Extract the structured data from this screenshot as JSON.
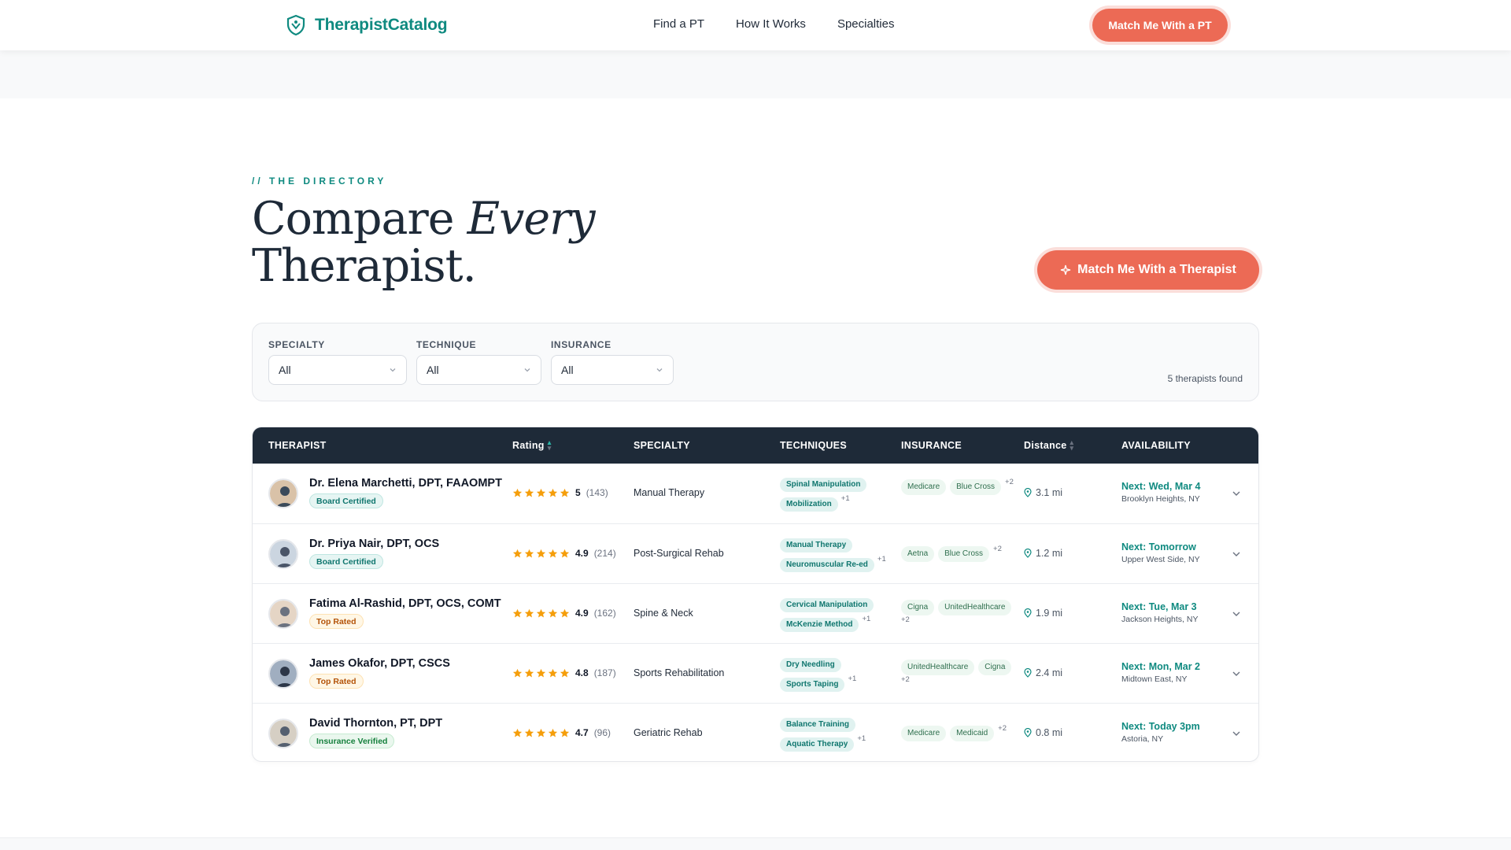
{
  "nav": {
    "brand": "TherapistCatalog",
    "links": [
      "Find a PT",
      "How It Works",
      "Specialties"
    ],
    "cta": "Match Me With a PT"
  },
  "hero": {
    "eyebrow": "// THE DIRECTORY",
    "title_line1_a": "Compare ",
    "title_line1_b": "Every",
    "title_line2": "Therapist.",
    "cta": "Match Me With a Therapist"
  },
  "filters": {
    "specialty": {
      "label": "SPECIALTY",
      "value": "All"
    },
    "technique": {
      "label": "TECHNIQUE",
      "value": "All"
    },
    "insurance": {
      "label": "INSURANCE",
      "value": "All"
    },
    "results": "5 therapists found"
  },
  "table": {
    "headers": {
      "therapist": "THERAPIST",
      "rating": "Rating",
      "specialty": "SPECIALTY",
      "techniques": "TECHNIQUES",
      "insurance": "INSURANCE",
      "distance": "Distance",
      "availability": "AVAILABILITY"
    },
    "rows": [
      {
        "name": "Dr. Elena Marchetti, DPT, FAAOMPT",
        "badge": "Board Certified",
        "badge_color": "#0f766e",
        "rating": "5",
        "reviews": "(143)",
        "stars": 5,
        "specialty": "Manual Therapy",
        "techniques": [
          "Spinal Manipulation",
          "Mobilization"
        ],
        "tech_more": "+1",
        "insurance": [
          "Medicare",
          "Blue Cross"
        ],
        "ins_more": "+2",
        "distance": "3.1 mi",
        "next": "Next: Wed, Mar 4",
        "location": "Brooklyn Heights, NY"
      },
      {
        "name": "Dr. Priya Nair, DPT, OCS",
        "badge": "Board Certified",
        "badge_color": "#0f766e",
        "rating": "4.9",
        "reviews": "(214)",
        "stars": 5,
        "specialty": "Post-Surgical Rehab",
        "techniques": [
          "Manual Therapy",
          "Neuromuscular Re-ed"
        ],
        "tech_more": "+1",
        "insurance": [
          "Aetna",
          "Blue Cross"
        ],
        "ins_more": "+2",
        "distance": "1.2 mi",
        "next": "Next: Tomorrow",
        "location": "Upper West Side, NY"
      },
      {
        "name": "Fatima Al-Rashid, DPT, OCS, COMT",
        "badge": "Top Rated",
        "badge_color": "#b45309",
        "rating": "4.9",
        "reviews": "(162)",
        "stars": 5,
        "specialty": "Spine & Neck",
        "techniques": [
          "Cervical Manipulation",
          "McKenzie Method"
        ],
        "tech_more": "+1",
        "insurance": [
          "Cigna",
          "UnitedHealthcare"
        ],
        "ins_more": "+2",
        "distance": "1.9 mi",
        "next": "Next: Tue, Mar 3",
        "location": "Jackson Heights, NY"
      },
      {
        "name": "James Okafor, DPT, CSCS",
        "badge": "Top Rated",
        "badge_color": "#b45309",
        "rating": "4.8",
        "reviews": "(187)",
        "stars": 5,
        "specialty": "Sports Rehabilitation",
        "techniques": [
          "Dry Needling",
          "Sports Taping"
        ],
        "tech_more": "+1",
        "insurance": [
          "UnitedHealthcare",
          "Cigna"
        ],
        "ins_more": "+2",
        "distance": "2.4 mi",
        "next": "Next: Mon, Mar 2",
        "location": "Midtown East, NY"
      },
      {
        "name": "David Thornton, PT, DPT",
        "badge": "Insurance Verified",
        "badge_color": "#15803d",
        "rating": "4.7",
        "reviews": "(96)",
        "stars": 5,
        "specialty": "Geriatric Rehab",
        "techniques": [
          "Balance Training",
          "Aquatic Therapy"
        ],
        "tech_more": "+1",
        "insurance": [
          "Medicare",
          "Medicaid"
        ],
        "ins_more": "+2",
        "distance": "0.8 mi",
        "next": "Next: Today 3pm",
        "location": "Astoria, NY"
      }
    ]
  },
  "colors": {
    "brand": "#0f8a80",
    "accent": "#ec6a55",
    "header_bg": "#1e2a38",
    "star": "#f59e0b"
  }
}
